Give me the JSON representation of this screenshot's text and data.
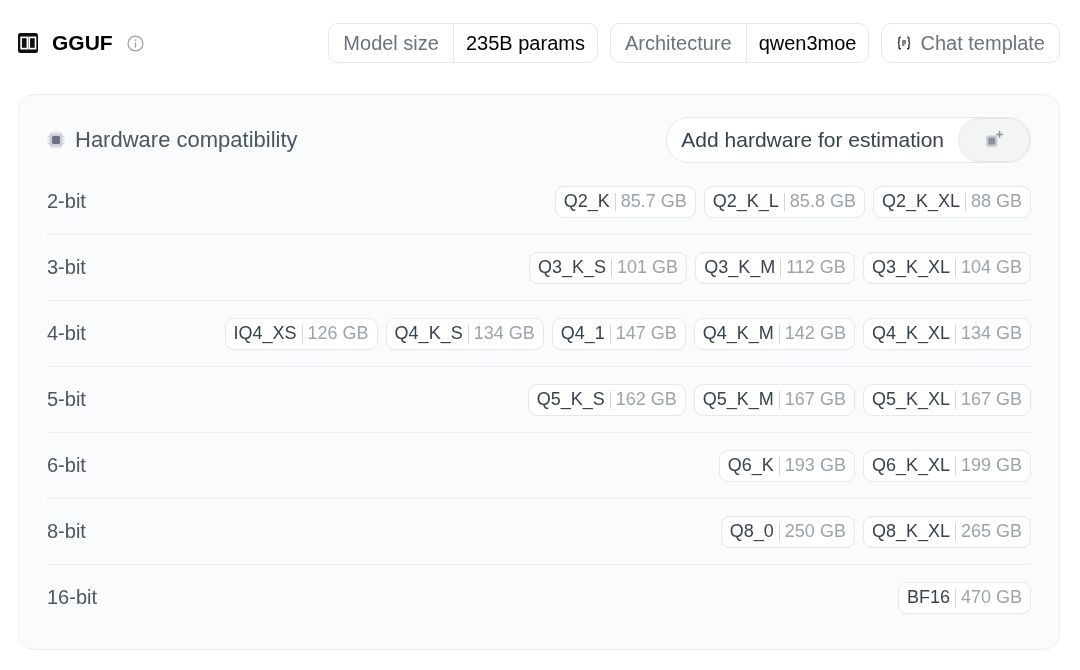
{
  "header": {
    "title": "GGUF",
    "meta": [
      {
        "label": "Model size",
        "value": "235B params"
      },
      {
        "label": "Architecture",
        "value": "qwen3moe"
      }
    ],
    "chat_template": "Chat template"
  },
  "hardware": {
    "title": "Hardware compatibility",
    "add_button": "Add hardware for estimation",
    "rows": [
      {
        "bits": "2-bit",
        "quants": [
          {
            "name": "Q2_K",
            "size": "85.7 GB"
          },
          {
            "name": "Q2_K_L",
            "size": "85.8 GB"
          },
          {
            "name": "Q2_K_XL",
            "size": "88 GB"
          }
        ]
      },
      {
        "bits": "3-bit",
        "quants": [
          {
            "name": "Q3_K_S",
            "size": "101 GB"
          },
          {
            "name": "Q3_K_M",
            "size": "112 GB"
          },
          {
            "name": "Q3_K_XL",
            "size": "104 GB"
          }
        ]
      },
      {
        "bits": "4-bit",
        "quants": [
          {
            "name": "IQ4_XS",
            "size": "126 GB"
          },
          {
            "name": "Q4_K_S",
            "size": "134 GB"
          },
          {
            "name": "Q4_1",
            "size": "147 GB"
          },
          {
            "name": "Q4_K_M",
            "size": "142 GB"
          },
          {
            "name": "Q4_K_XL",
            "size": "134 GB"
          }
        ]
      },
      {
        "bits": "5-bit",
        "quants": [
          {
            "name": "Q5_K_S",
            "size": "162 GB"
          },
          {
            "name": "Q5_K_M",
            "size": "167 GB"
          },
          {
            "name": "Q5_K_XL",
            "size": "167 GB"
          }
        ]
      },
      {
        "bits": "6-bit",
        "quants": [
          {
            "name": "Q6_K",
            "size": "193 GB"
          },
          {
            "name": "Q6_K_XL",
            "size": "199 GB"
          }
        ]
      },
      {
        "bits": "8-bit",
        "quants": [
          {
            "name": "Q8_0",
            "size": "250 GB"
          },
          {
            "name": "Q8_K_XL",
            "size": "265 GB"
          }
        ]
      },
      {
        "bits": "16-bit",
        "quants": [
          {
            "name": "BF16",
            "size": "470 GB"
          }
        ]
      }
    ]
  }
}
